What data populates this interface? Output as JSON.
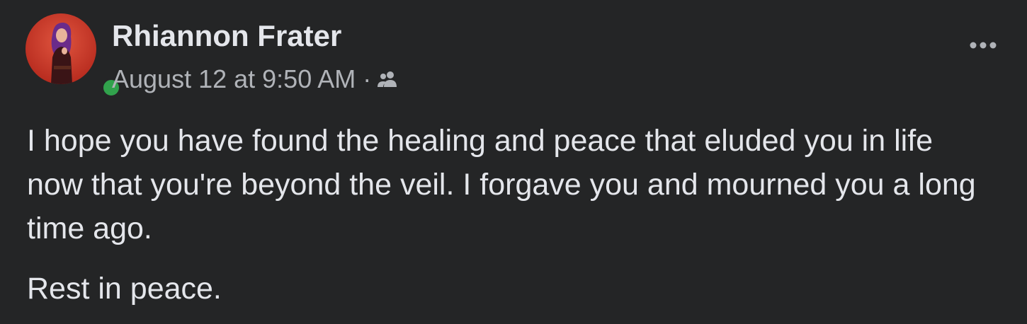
{
  "post": {
    "author": {
      "name": "Rhiannon Frater",
      "avatar_icon": "profile-photo",
      "online": true,
      "online_color": "#31a24c"
    },
    "timestamp": "August 12 at 9:50 AM",
    "separator": "·",
    "audience_icon": "friends-icon",
    "more_options_icon": "more-horizontal-icon",
    "body": {
      "paragraphs": [
        "I hope you have found the healing and peace that eluded you in life now that you're beyond the veil. I forgave you and mourned you a long time ago.",
        "Rest in peace."
      ]
    }
  },
  "colors": {
    "background": "#242526",
    "primary_text": "#e4e6eb",
    "secondary_text": "#b0b3b8",
    "avatar_background": "#c0392b"
  }
}
